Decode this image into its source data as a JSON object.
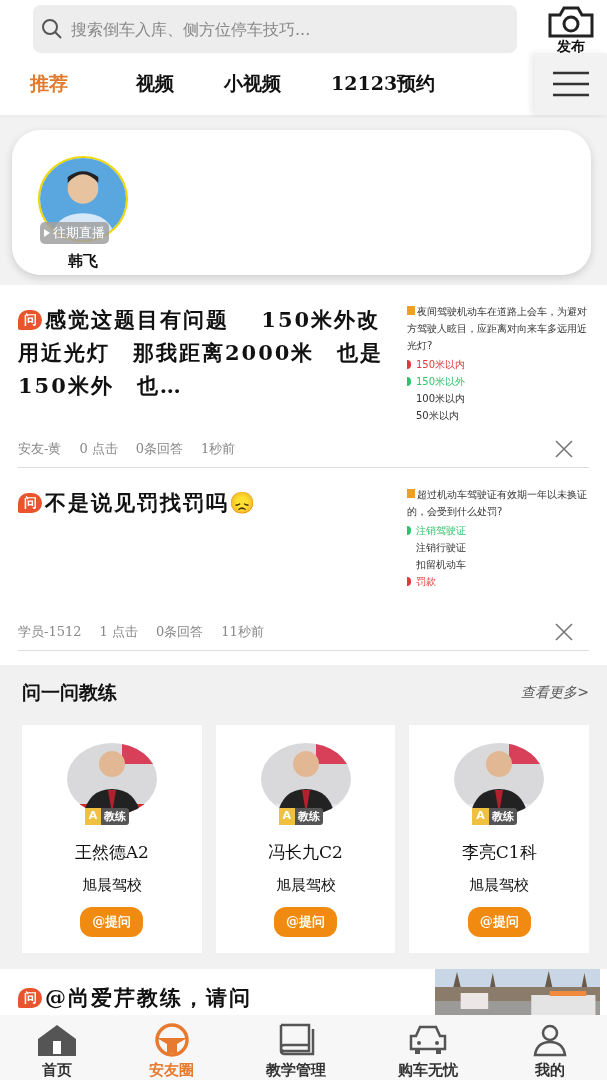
{
  "search": {
    "placeholder": "搜索倒车入库、侧方位停车技巧..."
  },
  "publish": {
    "label": "发布"
  },
  "tabs": [
    {
      "label": "推荐",
      "selected": true
    },
    {
      "label": "视频",
      "selected": false
    },
    {
      "label": "小视频",
      "selected": false
    },
    {
      "label": "12123预约",
      "selected": false
    }
  ],
  "live": {
    "name": "韩飞",
    "badge": "往期直播"
  },
  "posts": [
    {
      "badge": "问",
      "title": "感觉这题目有问题　 150米外改用近光灯　那我距离2000米　也是150米外　也…",
      "meta": [
        "安友-黄",
        "0 点击",
        "0条回答",
        "1秒前"
      ],
      "quiz": {
        "question": "夜间驾驶机动车在道路上会车，为避对方驾驶人眩目，应距离对向来车多远用近光灯?",
        "options": [
          {
            "text": "150米以内",
            "kind": "wrong"
          },
          {
            "text": "150米以外",
            "kind": "right"
          },
          {
            "text": "100米以内",
            "kind": "plain"
          },
          {
            "text": "50米以内",
            "kind": "plain"
          }
        ]
      }
    },
    {
      "badge": "问",
      "title": "不是说见罚找罚吗😞",
      "meta": [
        "学员-1512",
        "1 点击",
        "0条回答",
        "11秒前"
      ],
      "quiz": {
        "question": "超过机动车驾驶证有效期一年以未换证的，会受到什么处罚?",
        "options": [
          {
            "text": "注销驾驶证",
            "kind": "right"
          },
          {
            "text": "注销行驶证",
            "kind": "plain"
          },
          {
            "text": "扣留机动车",
            "kind": "plain"
          },
          {
            "text": "罚款",
            "kind": "wrong"
          }
        ]
      }
    }
  ],
  "coaches": {
    "title": "问一问教练",
    "more": "查看更多>",
    "items": [
      {
        "name": "王然德A2",
        "school": "旭晨驾校",
        "level": "A",
        "role": "教练",
        "button": "@提问"
      },
      {
        "name": "冯长九C2",
        "school": "旭晨驾校",
        "level": "A",
        "role": "教练",
        "button": "@提问"
      },
      {
        "name": "李亮C1科",
        "school": "旭晨驾校",
        "level": "A",
        "role": "教练",
        "button": "@提问"
      }
    ]
  },
  "last_post": {
    "badge": "问",
    "title": "@尚爱芹教练，请问"
  },
  "bottom_nav": [
    {
      "label": "首页",
      "kind": "home",
      "selected": false
    },
    {
      "label": "安友圈",
      "kind": "wheel",
      "selected": true
    },
    {
      "label": "教学管理",
      "kind": "book",
      "selected": false
    },
    {
      "label": "购车无忧",
      "kind": "car",
      "selected": false
    },
    {
      "label": "我的",
      "kind": "user",
      "selected": false
    }
  ]
}
